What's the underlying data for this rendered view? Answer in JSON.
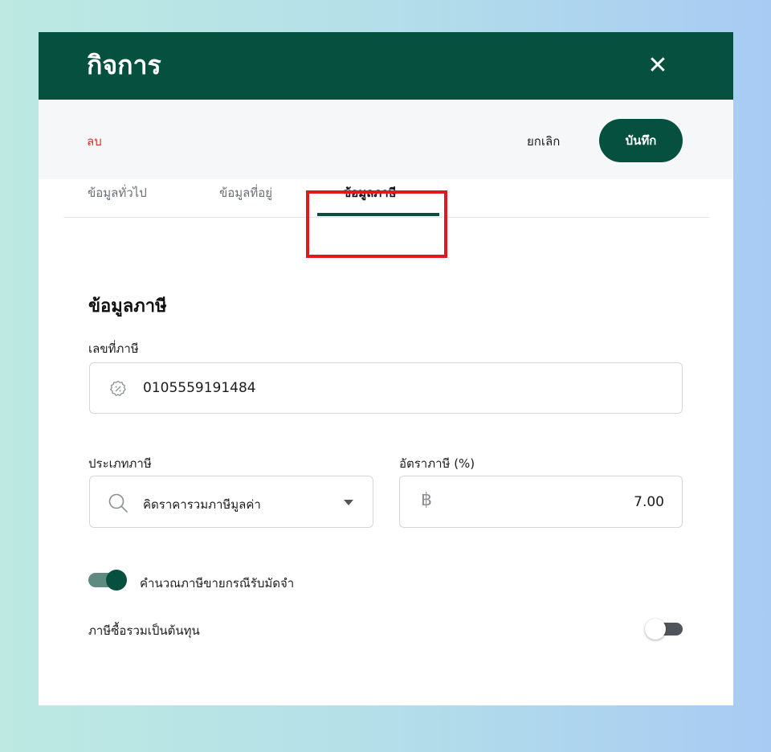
{
  "header": {
    "title": "กิจการ",
    "close_icon": "close-icon"
  },
  "toolbar": {
    "delete_label": "ลบ",
    "cancel_label": "ยกเลิก",
    "save_label": "บันทึก"
  },
  "tabs": [
    {
      "label": "ข้อมูลทั่วไป",
      "active": false
    },
    {
      "label": "ข้อมูลที่อยู่",
      "active": false
    },
    {
      "label": "ข้อมูลภาษี",
      "active": true
    }
  ],
  "section": {
    "title": "ข้อมูลภาษี"
  },
  "tax_id": {
    "label": "เลขที่ภาษี",
    "value": "0105559191484",
    "icon": "tax-badge-icon"
  },
  "tax_type": {
    "label": "ประเภทภาษี",
    "value": "คิดราคารวมภาษีมูลค่า",
    "icon": "search-icon"
  },
  "tax_rate": {
    "label": "อัตราภาษี (%)",
    "value": "7.00",
    "icon": "baht-icon"
  },
  "toggles": {
    "deposit": {
      "label": "คำนวณภาษีขายกรณีรับมัดจำ",
      "on": true
    },
    "purchase_cost": {
      "label": "ภาษีซื้อรวมเป็นต้นทุน",
      "on": false
    }
  },
  "colors": {
    "brand": "#06503f",
    "danger": "#d0362f",
    "highlight": "#e2181f"
  }
}
